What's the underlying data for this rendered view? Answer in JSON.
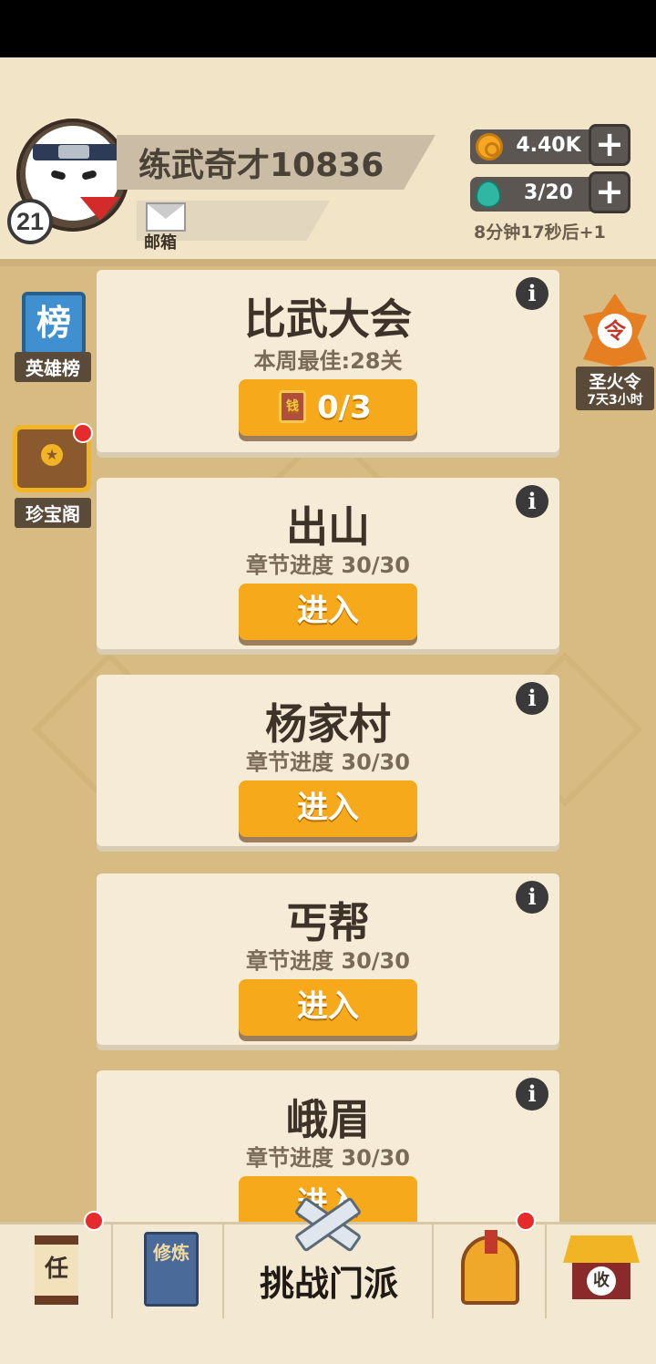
{
  "player": {
    "name": "练武奇才10836",
    "level": "21",
    "mail_label": "邮箱"
  },
  "resources": {
    "coins": "4.40K",
    "stamina": "3/20",
    "timer": "8分钟17秒后+1"
  },
  "side_left": {
    "rank_icon_text": "榜",
    "rank_label": "英雄榜",
    "treasure_label": "珍宝阁"
  },
  "side_right": {
    "flame_icon_text": "令",
    "flame_name": "圣火令",
    "flame_time": "7天3小时"
  },
  "tournament": {
    "title": "比武大会",
    "best": "本周最佳:28关",
    "ticket_icon": "钱",
    "tickets": "0/3"
  },
  "chapters": [
    {
      "title": "出山",
      "progress": "章节进度 30/30",
      "button": "进入"
    },
    {
      "title": "杨家村",
      "progress": "章节进度 30/30",
      "button": "进入"
    },
    {
      "title": "丐帮",
      "progress": "章节进度 30/30",
      "button": "进入"
    },
    {
      "title": "峨眉",
      "progress": "章节进度 30/30",
      "button": "进入"
    }
  ],
  "info_glyph": "i",
  "bottom_nav": {
    "task_icon": "任",
    "cultivate_icon": "修炼",
    "center_label": "挑战门派",
    "shop_icon": "收"
  },
  "colors": {
    "accent_button": "#f6a91b",
    "card_bg": "#f5ebd6",
    "page_bg": "#d8bb82",
    "badge_red": "#e52b2b"
  },
  "icons": [
    "avatar",
    "mail-icon",
    "coin-icon",
    "gem-icon",
    "plus-icon",
    "rank-icon",
    "treasure-chest-icon",
    "flame-token-icon",
    "info-icon",
    "ticket-icon",
    "task-scroll-icon",
    "cultivate-book-icon",
    "crossed-swords-icon",
    "helmet-icon",
    "shop-icon"
  ]
}
